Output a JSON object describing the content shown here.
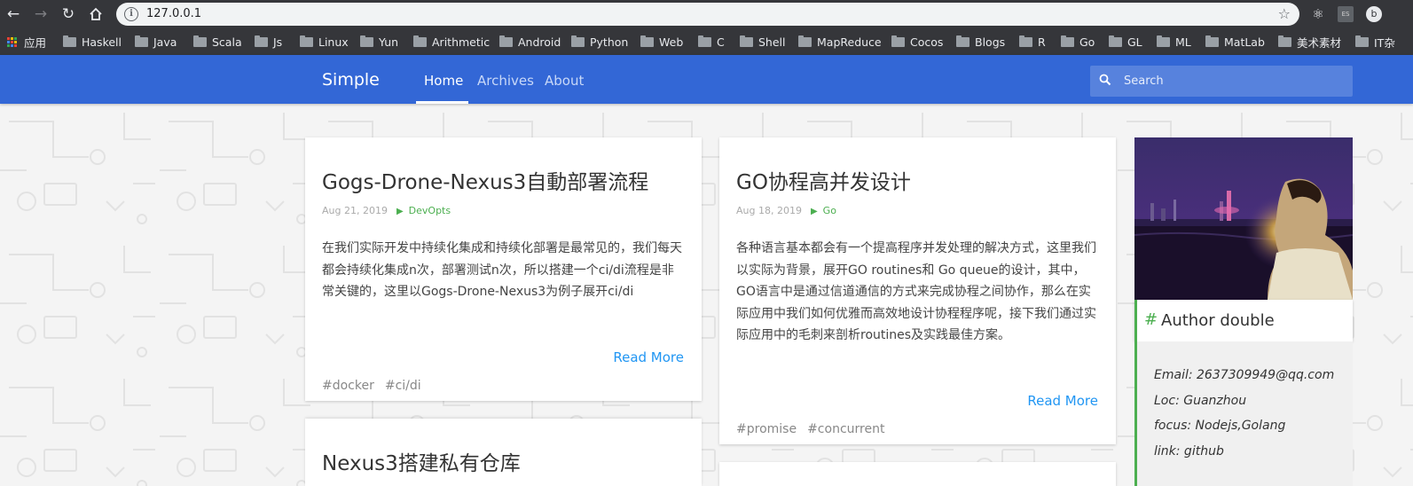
{
  "browser": {
    "url": "127.0.0.1",
    "bookmarks": [
      "应用",
      "Haskell",
      "Java",
      "Scala",
      "Js",
      "Linux",
      "Yun",
      "Arithmetic",
      "Android",
      "Python",
      "Web",
      "C",
      "Shell",
      "MapReduce",
      "Cocos",
      "Blogs",
      "R",
      "Go",
      "GL",
      "ML",
      "MatLab",
      "美术素材",
      "IT杂"
    ],
    "extension_es_label": "ES",
    "profile_initial": "b"
  },
  "site": {
    "brand": "Simple",
    "nav": [
      "Home",
      "Archives",
      "About"
    ],
    "active_nav": "Home",
    "search_placeholder": "Search",
    "accent_color": "#3367d6",
    "link_color": "#2196f3",
    "category_color": "#4caf50"
  },
  "posts": [
    {
      "title": "Gogs-Drone-Nexus3自動部署流程",
      "date": "Aug 21, 2019",
      "category": "DevOpts",
      "excerpt": "在我们实际开发中持续化集成和持续化部署是最常见的，我们每天都会持续化集成n次，部署测试n次，所以搭建一个ci/di流程是非常关键的，这里以Gogs-Drone-Nexus3为例子展开ci/di",
      "read_more": "Read More",
      "tags": [
        "#docker",
        "#ci/di"
      ]
    },
    {
      "title": "GO协程高并发设计",
      "date": "Aug 18, 2019",
      "category": "Go",
      "excerpt": "各种语言基本都会有一个提高程序并发处理的解决方式，这里我们以实际为背景，展开GO routines和 Go queue的设计，其中，GO语言中是通过信道通信的方式来完成协程之间协作，那么在实际应用中我们如何优雅而高效地设计协程程序呢，接下我们通过实际应用中的毛刺来剖析routines及实践最佳方案。",
      "read_more": "Read More",
      "tags": [
        "#promise",
        "#concurrent"
      ]
    },
    {
      "title": "Nexus3搭建私有仓库"
    }
  ],
  "author": {
    "hash": "#",
    "name": "Author double",
    "email": "Email: 2637309949@qq.com",
    "loc": "Loc: Guanzhou",
    "focus": "focus: Nodejs,Golang",
    "link": "link: github"
  }
}
